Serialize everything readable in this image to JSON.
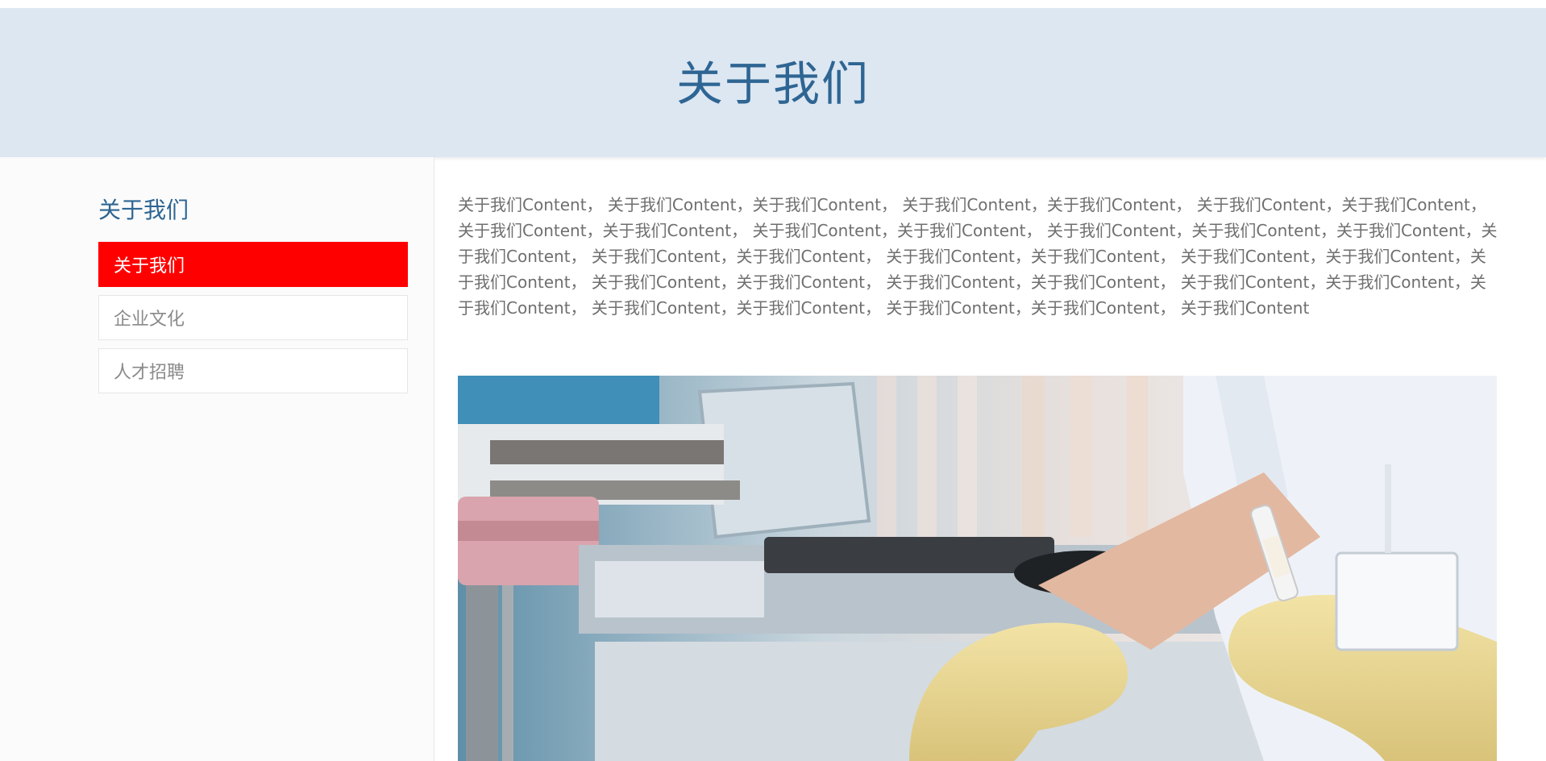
{
  "banner": {
    "title": "关于我们"
  },
  "sidebar": {
    "heading": "关于我们",
    "items": [
      {
        "label": "关于我们",
        "active": true
      },
      {
        "label": "企业文化",
        "active": false
      },
      {
        "label": "人才招聘",
        "active": false
      }
    ]
  },
  "main": {
    "paragraph": "关于我们Content， 关于我们Content，关于我们Content， 关于我们Content，关于我们Content， 关于我们Content，关于我们Content， 关于我们Content，关于我们Content， 关于我们Content，关于我们Content， 关于我们Content，关于我们Content，关于我们Content，关于我们Content， 关于我们Content，关于我们Content， 关于我们Content，关于我们Content， 关于我们Content，关于我们Content，关于我们Content， 关于我们Content，关于我们Content， 关于我们Content，关于我们Content， 关于我们Content，关于我们Content，关于我们Content， 关于我们Content，关于我们Content， 关于我们Content，关于我们Content， 关于我们Content"
  },
  "colors": {
    "accent": "#2e6593",
    "active_bg": "#ff0000",
    "banner_bg": "#dce7f2"
  },
  "image": {
    "subject": "laboratory-photo"
  }
}
